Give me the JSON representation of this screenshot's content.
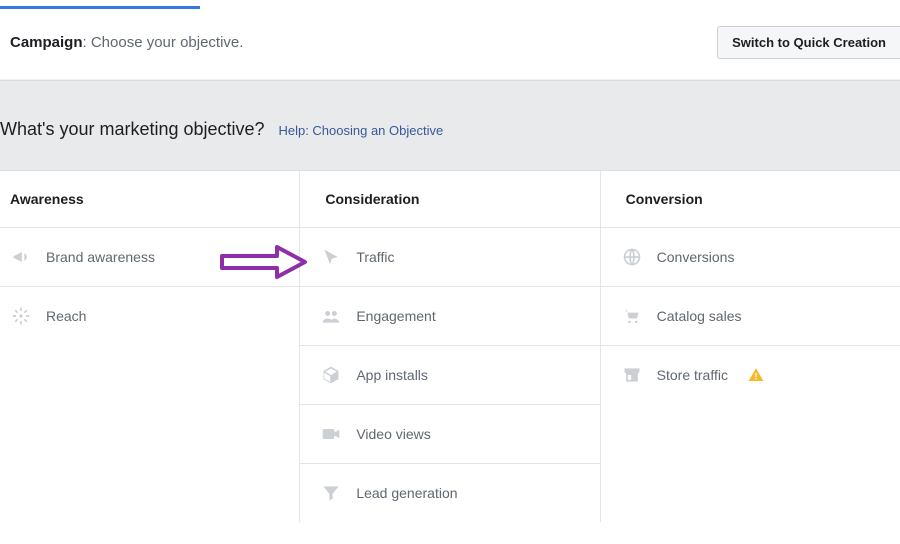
{
  "header": {
    "campaign_label": "Campaign",
    "campaign_sub": ": Choose your objective.",
    "switch_btn": "Switch to Quick Creation"
  },
  "question": {
    "text": "What's your marketing objective?",
    "help_label": "Help: Choosing an Objective"
  },
  "columns": [
    {
      "title": "Awareness",
      "options": [
        {
          "icon": "megaphone",
          "label": "Brand awareness"
        },
        {
          "icon": "reach",
          "label": "Reach"
        }
      ]
    },
    {
      "title": "Consideration",
      "options": [
        {
          "icon": "cursor",
          "label": "Traffic"
        },
        {
          "icon": "people",
          "label": "Engagement"
        },
        {
          "icon": "box",
          "label": "App installs"
        },
        {
          "icon": "video",
          "label": "Video views"
        },
        {
          "icon": "funnel",
          "label": "Lead generation"
        }
      ]
    },
    {
      "title": "Conversion",
      "options": [
        {
          "icon": "globe",
          "label": "Conversions"
        },
        {
          "icon": "cart",
          "label": "Catalog sales"
        },
        {
          "icon": "store",
          "label": "Store traffic",
          "warning": true
        }
      ]
    }
  ]
}
